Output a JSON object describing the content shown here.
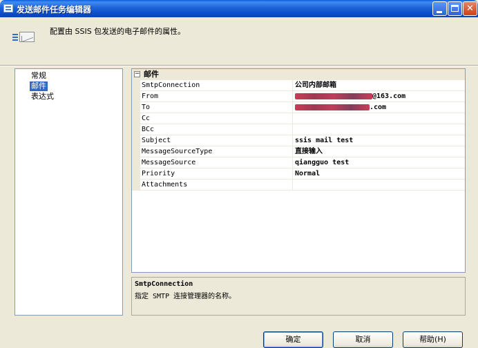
{
  "window": {
    "title": "发送邮件任务编辑器",
    "controls": {
      "minimize": "_",
      "maximize": "□",
      "close": "✕"
    }
  },
  "header": {
    "icon": "mail-envelope-icon",
    "description": "配置由 SSIS 包发送的电子邮件的属性。"
  },
  "nav": {
    "items": [
      {
        "label": "常规",
        "selected": false
      },
      {
        "label": "邮件",
        "selected": true
      },
      {
        "label": "表达式",
        "selected": false
      }
    ]
  },
  "grid": {
    "category": {
      "label": "邮件",
      "toggle": "⊟"
    },
    "rows": [
      {
        "name": "SmtpConnection",
        "value": "公司内部邮箱"
      },
      {
        "name": "From",
        "value": "@163.com",
        "redacted": true
      },
      {
        "name": "To",
        "value": ".com",
        "redacted": true
      },
      {
        "name": "Cc",
        "value": ""
      },
      {
        "name": "BCc",
        "value": ""
      },
      {
        "name": "Subject",
        "value": "ssis mail test"
      },
      {
        "name": "MessageSourceType",
        "value": "直接输入"
      },
      {
        "name": "MessageSource",
        "value": "qiangguo test"
      },
      {
        "name": "Priority",
        "value": "Normal"
      },
      {
        "name": "Attachments",
        "value": ""
      }
    ]
  },
  "description": {
    "title": "SmtpConnection",
    "text": "指定 SMTP 连接管理器的名称。"
  },
  "buttons": {
    "ok": "确定",
    "cancel": "取消",
    "help": "帮助(H)"
  }
}
